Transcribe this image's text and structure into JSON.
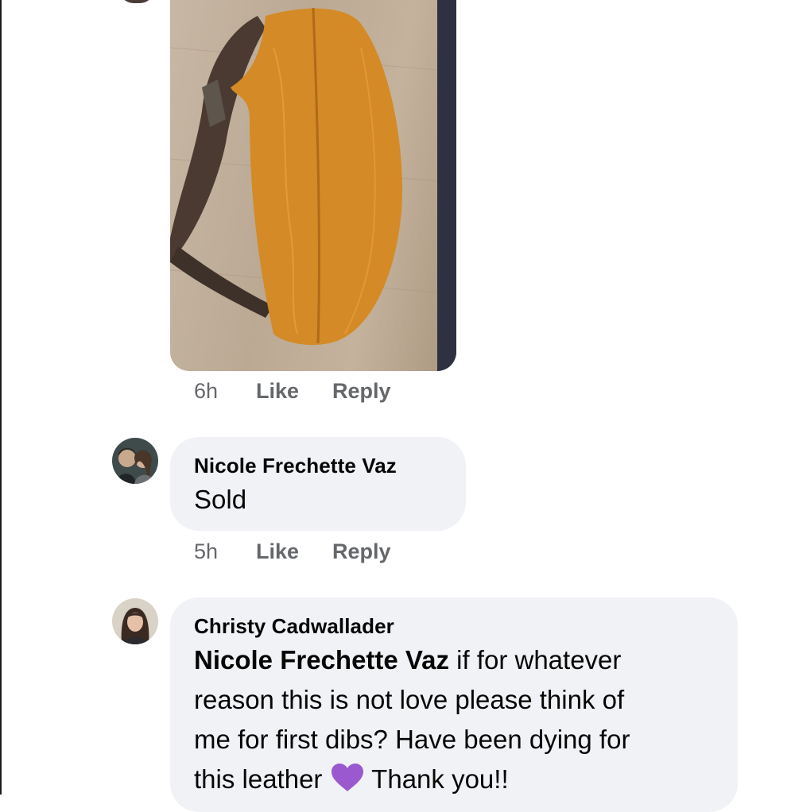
{
  "photo_comment": {
    "photo": {
      "alt_subject": "orange leather bag on wood floor"
    },
    "meta": {
      "time": "6h",
      "like": "Like",
      "reply": "Reply"
    }
  },
  "comments": [
    {
      "author": "Nicole Frechette Vaz",
      "text": "Sold",
      "meta": {
        "time": "5h",
        "like": "Like",
        "reply": "Reply"
      }
    },
    {
      "author": "Christy Cadwallader",
      "mention": "Nicole Frechette Vaz",
      "text_lines": [
        " if for whatever",
        "reason this is not love please think of",
        "me for first dibs? Have been dying for",
        "this leather"
      ],
      "emoji": "purple-heart",
      "text_after_emoji": " Thank you!!"
    }
  ],
  "colors": {
    "bubble": "#f0f2f5",
    "meta_text": "#65676b",
    "text": "#050505",
    "heart": "#9b59d0"
  }
}
